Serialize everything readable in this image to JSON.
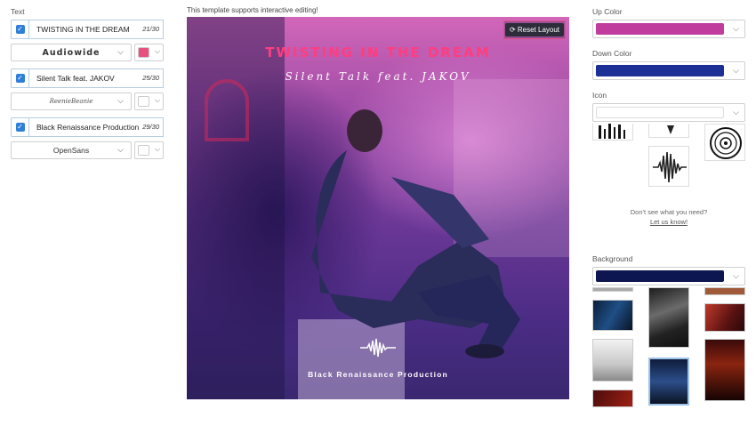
{
  "left_panel": {
    "text_label": "Text",
    "rows": [
      {
        "checked": true,
        "value": "TWISTING IN THE DREAM",
        "count": "21/30",
        "font": "Audiowide",
        "color": "#e8507f"
      },
      {
        "checked": true,
        "value": "Silent Talk feat. JAKOV",
        "count": "25/30",
        "font": "ReenieBeanie",
        "color": "#ffffff"
      },
      {
        "checked": true,
        "value": "Black Renaissance Production",
        "count": "29/30",
        "font": "OpenSans",
        "color": "#ffffff"
      }
    ]
  },
  "canvas": {
    "hint": "This template supports interactive editing!",
    "reset_label": "Reset Layout",
    "title": "TWISTING IN THE DREAM",
    "subtitle": "Silent Talk feat. JAKOV",
    "footer": "Black Renaissance Production"
  },
  "right_panel": {
    "up_color_label": "Up Color",
    "up_color": "#c03c9d",
    "down_color_label": "Down Color",
    "down_color": "#1b2f97",
    "icon_label": "Icon",
    "help_text": "Don't see what you need?",
    "help_link": "Let us know!",
    "background_label": "Background",
    "background_color": "#0d1650"
  },
  "icons": {
    "checkbox": "check-icon",
    "dropdown": "chevron-down-icon",
    "reset": "refresh-icon",
    "waveform": "waveform-icon",
    "vinyl": "vinyl-record-icon"
  }
}
